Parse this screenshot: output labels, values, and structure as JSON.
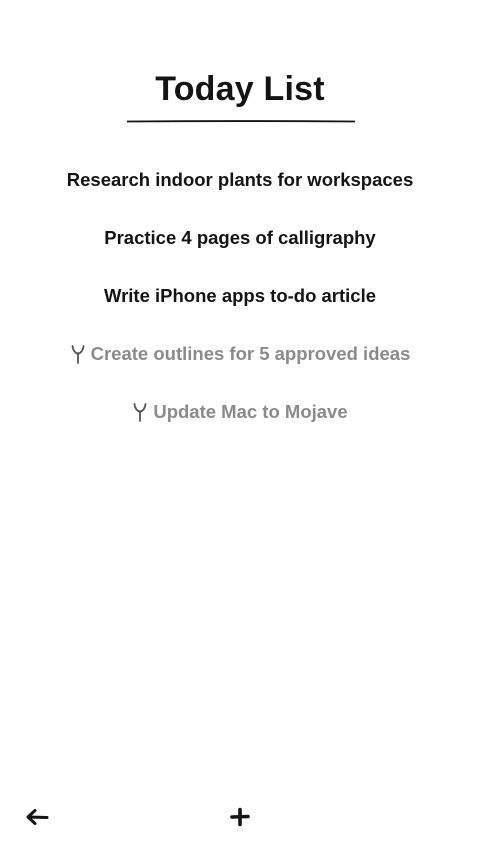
{
  "header": {
    "title": "Today List"
  },
  "tasks": [
    {
      "label": "Research indoor plants for workspaces",
      "completed": false
    },
    {
      "label": "Practice 4 pages of calligraphy",
      "completed": false
    },
    {
      "label": "Write iPhone apps to-do article",
      "completed": false
    },
    {
      "label": "Create outlines for 5 approved ideas",
      "completed": true
    },
    {
      "label": "Update Mac to Mojave",
      "completed": true
    }
  ],
  "icons": {
    "back": "arrow-left-icon",
    "add": "plus-icon",
    "completed": "sprout-icon"
  },
  "colors": {
    "text": "#141414",
    "completed_text": "#8b8b8b",
    "background": "#ffffff"
  }
}
